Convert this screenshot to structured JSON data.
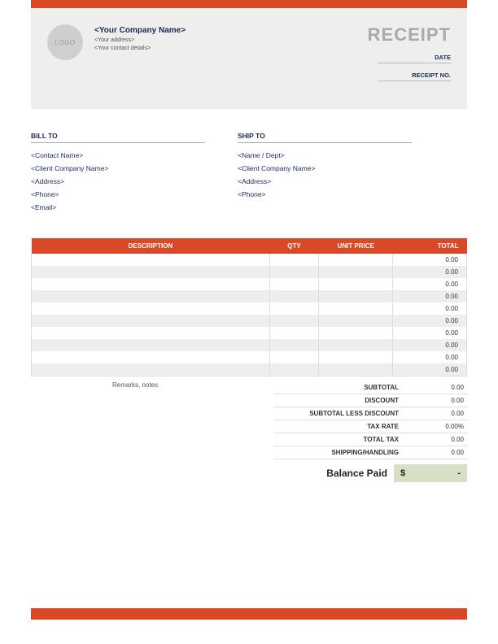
{
  "header": {
    "logo_text": "LOGO",
    "company_name": "<Your Company Name>",
    "address": "<Your address>",
    "contact": "<Your contact details>",
    "title": "RECEIPT",
    "date_label": "DATE",
    "receipt_no_label": "RECEIPT NO."
  },
  "bill_to": {
    "heading": "BILL TO",
    "lines": [
      "<Contact Name>",
      "<Client Company Name>",
      "<Address>",
      "<Phone>",
      "<Email>"
    ]
  },
  "ship_to": {
    "heading": "SHIP TO",
    "lines": [
      "<Name / Dept>",
      "<Client Company Name>",
      "<Address>",
      "<Phone>"
    ]
  },
  "table": {
    "headers": {
      "description": "DESCRIPTION",
      "qty": "QTY",
      "unit_price": "UNIT PRICE",
      "total": "TOTAL"
    },
    "rows": [
      {
        "desc": "",
        "qty": "",
        "price": "",
        "total": "0.00"
      },
      {
        "desc": "",
        "qty": "",
        "price": "",
        "total": "0.00"
      },
      {
        "desc": "",
        "qty": "",
        "price": "",
        "total": "0.00"
      },
      {
        "desc": "",
        "qty": "",
        "price": "",
        "total": "0.00"
      },
      {
        "desc": "",
        "qty": "",
        "price": "",
        "total": "0.00"
      },
      {
        "desc": "",
        "qty": "",
        "price": "",
        "total": "0.00"
      },
      {
        "desc": "",
        "qty": "",
        "price": "",
        "total": "0.00"
      },
      {
        "desc": "",
        "qty": "",
        "price": "",
        "total": "0.00"
      },
      {
        "desc": "",
        "qty": "",
        "price": "",
        "total": "0.00"
      },
      {
        "desc": "",
        "qty": "",
        "price": "",
        "total": "0.00"
      }
    ]
  },
  "remarks": "Remarks, notes",
  "totals": {
    "subtotal": {
      "label": "SUBTOTAL",
      "value": "0.00"
    },
    "discount": {
      "label": "DISCOUNT",
      "value": "0.00"
    },
    "sub_less": {
      "label": "SUBTOTAL LESS DISCOUNT",
      "value": "0.00"
    },
    "tax_rate": {
      "label": "TAX RATE",
      "value": "0.00%"
    },
    "total_tax": {
      "label": "TOTAL TAX",
      "value": "0.00"
    },
    "shipping": {
      "label": "SHIPPING/HANDLING",
      "value": "0.00"
    }
  },
  "balance": {
    "label": "Balance Paid",
    "currency": "$",
    "value": "-"
  }
}
